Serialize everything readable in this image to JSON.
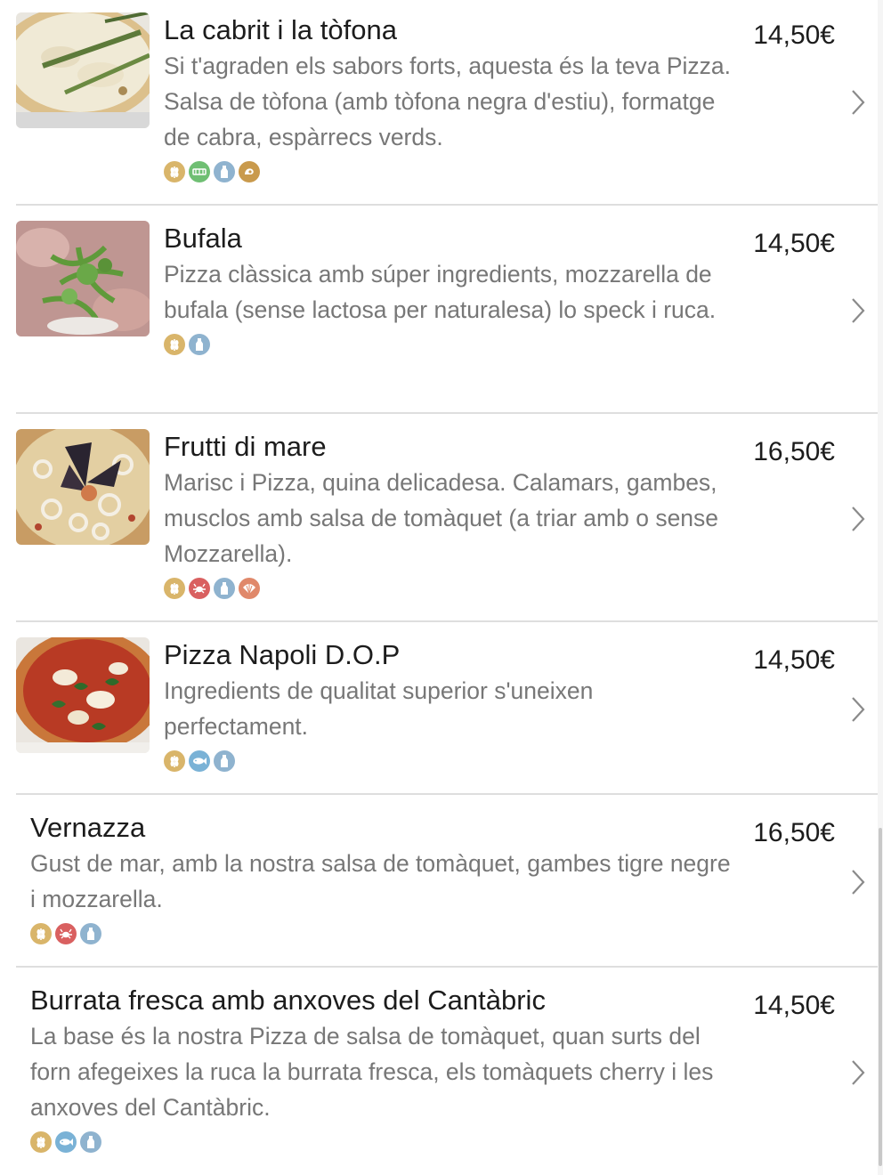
{
  "colors": {
    "gluten": "#d9b56a",
    "sulphites": "#6fbf73",
    "lactose": "#8fb3cf",
    "mollusc": "#c99a4c",
    "crustacean": "#d96060",
    "fish": "#7ab2d6",
    "divider": "#dedede"
  },
  "items": [
    {
      "title": "La cabrit i la tòfona",
      "description": "Si t'agraden els sabors forts, aquesta és la teva Pizza. Salsa de tòfona (amb tòfona negra d'estiu), formatge de cabra, espàrrecs verds.",
      "price": "14,50€",
      "image": "pizza-asparagus",
      "allergens": [
        "gluten-icon",
        "sulphites-icon",
        "lactose-icon",
        "mollusc-icon"
      ]
    },
    {
      "title": "Bufala",
      "description": "Pizza clàssica amb súper ingredients, mozzarella de bufala (sense lactosa per naturalesa) lo speck i ruca.",
      "price": "14,50€",
      "image": "pizza-arugula",
      "allergens": [
        "gluten-icon",
        "lactose-icon"
      ]
    },
    {
      "title": "Frutti di mare",
      "description": "Marisc i Pizza, quina delicadesa. Calamars, gambes, musclos amb salsa de tomàquet (a triar amb o sense Mozzarella).",
      "price": "16,50€",
      "image": "pizza-seafood",
      "allergens": [
        "gluten-icon",
        "crustacean-icon",
        "lactose-icon",
        "shellfish-icon"
      ]
    },
    {
      "title": "Pizza Napoli D.O.P",
      "description": "Ingredients de qualitat superior s'uneixen perfectament.",
      "price": "14,50€",
      "image": "pizza-napoli",
      "allergens": [
        "gluten-icon",
        "fish-icon",
        "lactose-icon"
      ]
    },
    {
      "title": "Vernazza",
      "description": "Gust de mar, amb la nostra salsa de tomàquet, gambes tigre negre i mozzarella.",
      "price": "16,50€",
      "allergens": [
        "gluten-icon",
        "crustacean-icon",
        "lactose-icon"
      ]
    },
    {
      "title": "Burrata fresca amb anxoves del Cantàbric",
      "description": "La base és la nostra Pizza de salsa de tomàquet, quan surts del forn afegeixes la ruca la burrata fresca, els tomàquets cherry i les anxoves del Cantàbric.",
      "price": "14,50€",
      "allergens": [
        "gluten-icon",
        "fish-icon",
        "lactose-icon"
      ]
    }
  ]
}
